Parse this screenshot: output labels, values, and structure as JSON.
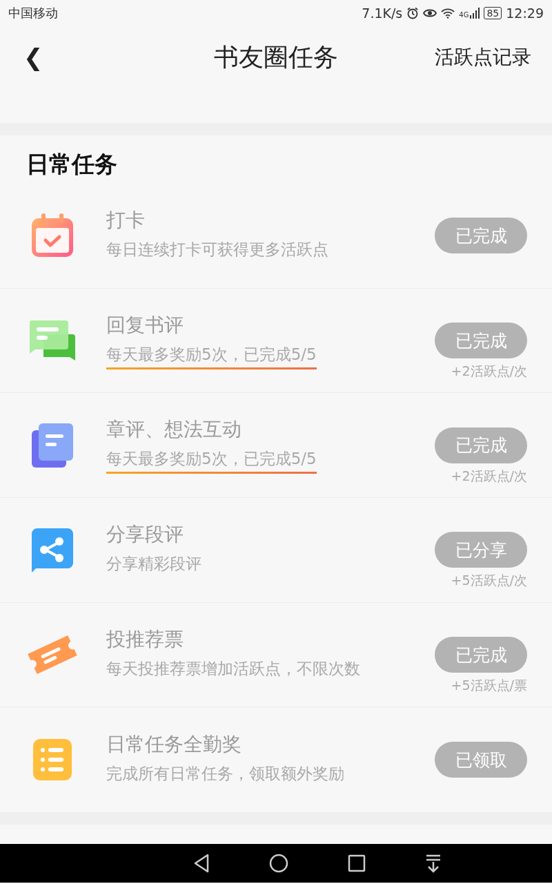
{
  "status_bar": {
    "carrier": "中国移动",
    "speed": "7.1K/s",
    "network": "4G",
    "battery": "85",
    "time": "12:29"
  },
  "header": {
    "back": "❮",
    "title": "书友圈任务",
    "action": "活跃点记录"
  },
  "daily": {
    "title": "日常任务",
    "tasks": [
      {
        "kind": "calendar",
        "title": "打卡",
        "desc": "每日连续打卡可获得更多活跃点",
        "highlighted": false,
        "button": "已完成",
        "done": true
      },
      {
        "kind": "chat",
        "title": "回复书评",
        "desc": "每天最多奖励5次，已完成5/5",
        "highlighted": true,
        "button": "已完成",
        "done": true,
        "reward": "+2活跃点/次"
      },
      {
        "kind": "doc",
        "title": "章评、想法互动",
        "desc": "每天最多奖励5次，已完成5/5",
        "highlighted": true,
        "button": "已完成",
        "done": true,
        "reward": "+2活跃点/次"
      },
      {
        "kind": "share",
        "title": "分享段评",
        "desc": "分享精彩段评",
        "highlighted": false,
        "button": "已分享",
        "done": true,
        "reward": "+5活跃点/次"
      },
      {
        "kind": "ticket",
        "title": "投推荐票",
        "desc": "每天投推荐票增加活跃点，不限次数",
        "highlighted": false,
        "button": "已完成",
        "done": true,
        "reward": "+5活跃点/票"
      },
      {
        "kind": "list",
        "title": "日常任务全勤奖",
        "desc": "完成所有日常任务，领取额外奖励",
        "highlighted": false,
        "button": "已领取",
        "done": true
      }
    ]
  }
}
